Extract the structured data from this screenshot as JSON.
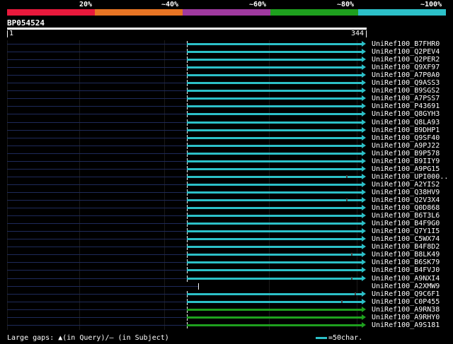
{
  "identity_scale": {
    "segments": [
      {
        "label": "20%",
        "color": "#e8193c"
      },
      {
        "label": "~40%",
        "color": "#e87524"
      },
      {
        "label": "~60%",
        "color": "#a03aa0"
      },
      {
        "label": "~80%",
        "color": "#1ea01e"
      },
      {
        "label": "~100%",
        "color": "#2cc0c8"
      }
    ]
  },
  "query": {
    "name": "BP054524",
    "start_label": "1",
    "end_label": "344",
    "length": 344
  },
  "hits": [
    {
      "id": "UniRef100_B7FHR0",
      "start": 172,
      "end": 340,
      "color": "#2cc0c8"
    },
    {
      "id": "UniRef100_Q2PEV4",
      "start": 172,
      "end": 340,
      "color": "#2cc0c8"
    },
    {
      "id": "UniRef100_Q2PER2",
      "start": 172,
      "end": 340,
      "color": "#2cc0c8"
    },
    {
      "id": "UniRef100_Q9XF97",
      "start": 172,
      "end": 340,
      "color": "#2cc0c8"
    },
    {
      "id": "UniRef100_A7P0A0",
      "start": 172,
      "end": 340,
      "color": "#2cc0c8"
    },
    {
      "id": "UniRef100_Q9ASS3",
      "start": 172,
      "end": 340,
      "color": "#2cc0c8"
    },
    {
      "id": "UniRef100_B9SGS2",
      "start": 172,
      "end": 340,
      "color": "#2cc0c8"
    },
    {
      "id": "UniRef100_A7PSS7",
      "start": 172,
      "end": 340,
      "color": "#2cc0c8"
    },
    {
      "id": "UniRef100_P43691",
      "start": 172,
      "end": 340,
      "color": "#2cc0c8"
    },
    {
      "id": "UniRef100_Q8GYH3",
      "start": 172,
      "end": 340,
      "color": "#2cc0c8"
    },
    {
      "id": "UniRef100_Q8LA93",
      "start": 172,
      "end": 340,
      "color": "#2cc0c8"
    },
    {
      "id": "UniRef100_B9DHP1",
      "start": 172,
      "end": 340,
      "color": "#2cc0c8"
    },
    {
      "id": "UniRef100_Q9SF40",
      "start": 172,
      "end": 340,
      "color": "#2cc0c8"
    },
    {
      "id": "UniRef100_A9PJ22",
      "start": 172,
      "end": 340,
      "color": "#2cc0c8"
    },
    {
      "id": "UniRef100_B9P578",
      "start": 172,
      "end": 340,
      "color": "#2cc0c8"
    },
    {
      "id": "UniRef100_B9IIY9",
      "start": 172,
      "end": 340,
      "color": "#2cc0c8"
    },
    {
      "id": "UniRef100_A9PG15",
      "start": 172,
      "end": 340,
      "color": "#2cc0c8"
    },
    {
      "id": "UniRef100_UPI000..",
      "start": 172,
      "end": 340,
      "color": "#2cc0c8",
      "gap_at": 325
    },
    {
      "id": "UniRef100_A2YIS2",
      "start": 172,
      "end": 340,
      "color": "#2cc0c8"
    },
    {
      "id": "UniRef100_Q38HV9",
      "start": 172,
      "end": 340,
      "color": "#2cc0c8"
    },
    {
      "id": "UniRef100_Q2V3X4",
      "start": 172,
      "end": 340,
      "color": "#2cc0c8",
      "gap_at": 325
    },
    {
      "id": "UniRef100_Q0D868",
      "start": 172,
      "end": 340,
      "color": "#2cc0c8"
    },
    {
      "id": "UniRef100_B6T3L6",
      "start": 172,
      "end": 340,
      "color": "#2cc0c8"
    },
    {
      "id": "UniRef100_B4F9G0",
      "start": 172,
      "end": 340,
      "color": "#2cc0c8"
    },
    {
      "id": "UniRef100_Q7Y1I5",
      "start": 172,
      "end": 340,
      "color": "#2cc0c8"
    },
    {
      "id": "UniRef100_C5WX74",
      "start": 172,
      "end": 340,
      "color": "#2cc0c8"
    },
    {
      "id": "UniRef100_B4F8D2",
      "start": 172,
      "end": 340,
      "color": "#2cc0c8"
    },
    {
      "id": "UniRef100_B8LK49",
      "start": 172,
      "end": 340,
      "color": "#2cc0c8",
      "gap_at": 330
    },
    {
      "id": "UniRef100_B6SK79",
      "start": 172,
      "end": 340,
      "color": "#2cc0c8"
    },
    {
      "id": "UniRef100_B4FVJ0",
      "start": 172,
      "end": 340,
      "color": "#2cc0c8"
    },
    {
      "id": "UniRef100_A9NXI4",
      "start": 172,
      "end": 340,
      "color": "#2cc0c8",
      "gap_at": 330
    },
    {
      "id": "UniRef100_A2XMW9",
      "start": 183,
      "end": 183,
      "color": "#2cc0c8"
    },
    {
      "id": "UniRef100_Q9C6F1",
      "start": 172,
      "end": 340,
      "color": "#2cc0c8",
      "gap_at": 333
    },
    {
      "id": "UniRef100_C0P455",
      "start": 172,
      "end": 340,
      "color": "#2cc0c8",
      "gap_at": 320
    },
    {
      "id": "UniRef100_A9RN38",
      "start": 172,
      "end": 340,
      "color": "#1ea01e"
    },
    {
      "id": "UniRef100_A9RHY0",
      "start": 172,
      "end": 340,
      "color": "#1ea01e"
    },
    {
      "id": "UniRef100_A9S181",
      "start": 172,
      "end": 340,
      "color": "#1ea01e"
    }
  ],
  "footer": {
    "large_gaps_label": "Large gaps: ▲(in Query)/– (in Subject)",
    "char_scale_label": "=50char."
  }
}
